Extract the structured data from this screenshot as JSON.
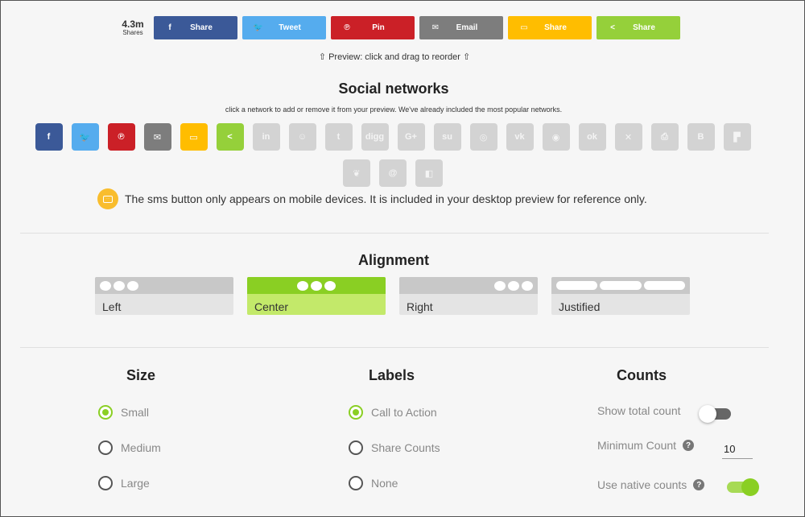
{
  "colors": {
    "facebook": "#3b5998",
    "twitter": "#55acee",
    "pinterest": "#cb2027",
    "email": "#7d7d7d",
    "sms": "#ffbd00",
    "share": "#95d03a",
    "inactive": "#d3d3d3",
    "accent": "#8acf23"
  },
  "share_bar": {
    "total_count": "4.3m",
    "total_label": "Shares",
    "buttons": [
      {
        "network": "facebook",
        "icon": "facebook-icon",
        "glyph": "f",
        "label": "Share"
      },
      {
        "network": "twitter",
        "icon": "twitter-icon",
        "glyph": "🐦",
        "label": "Tweet"
      },
      {
        "network": "pinterest",
        "icon": "pinterest-icon",
        "glyph": "℗",
        "label": "Pin"
      },
      {
        "network": "email",
        "icon": "email-icon",
        "glyph": "✉",
        "label": "Email"
      },
      {
        "network": "sms",
        "icon": "sms-icon",
        "glyph": "▭",
        "label": "Share"
      },
      {
        "network": "share",
        "icon": "share-icon",
        "glyph": "<",
        "label": "Share"
      }
    ]
  },
  "preview_note": "⇧ Preview: click and drag to reorder ⇧",
  "social_networks": {
    "title": "Social networks",
    "subtitle": "click a network to add or remove it from your preview. We've already included the most popular networks.",
    "networks": [
      {
        "name": "facebook",
        "icon": "facebook-icon",
        "glyph": "f",
        "active": true,
        "color": "#3b5998"
      },
      {
        "name": "twitter",
        "icon": "twitter-icon",
        "glyph": "🐦",
        "active": true,
        "color": "#55acee"
      },
      {
        "name": "pinterest",
        "icon": "pinterest-icon",
        "glyph": "℗",
        "active": true,
        "color": "#cb2027"
      },
      {
        "name": "email",
        "icon": "email-icon",
        "glyph": "✉",
        "active": true,
        "color": "#7d7d7d"
      },
      {
        "name": "sms",
        "icon": "sms-icon",
        "glyph": "▭",
        "active": true,
        "color": "#ffbd00"
      },
      {
        "name": "share",
        "icon": "share-icon",
        "glyph": "<",
        "active": true,
        "color": "#95d03a"
      },
      {
        "name": "linkedin",
        "icon": "linkedin-icon",
        "glyph": "in",
        "active": false
      },
      {
        "name": "reddit",
        "icon": "reddit-icon",
        "glyph": "☺",
        "active": false
      },
      {
        "name": "tumblr",
        "icon": "tumblr-icon",
        "glyph": "t",
        "active": false
      },
      {
        "name": "digg",
        "icon": "digg-icon",
        "glyph": "digg",
        "active": false
      },
      {
        "name": "google-plus",
        "icon": "google-plus-icon",
        "glyph": "G+",
        "active": false
      },
      {
        "name": "stumbleupon",
        "icon": "stumbleupon-icon",
        "glyph": "su",
        "active": false
      },
      {
        "name": "whatsapp",
        "icon": "whatsapp-icon",
        "glyph": "◎",
        "active": false
      },
      {
        "name": "vk",
        "icon": "vk-icon",
        "glyph": "vk",
        "active": false
      },
      {
        "name": "weibo",
        "icon": "weibo-icon",
        "glyph": "◉",
        "active": false
      },
      {
        "name": "odnoklassniki",
        "icon": "odnoklassniki-icon",
        "glyph": "ok",
        "active": false
      },
      {
        "name": "xing",
        "icon": "xing-icon",
        "glyph": "✕",
        "active": false
      },
      {
        "name": "print",
        "icon": "print-icon",
        "glyph": "⎙",
        "active": false
      },
      {
        "name": "blogger",
        "icon": "blogger-icon",
        "glyph": "B",
        "active": false
      },
      {
        "name": "flipboard",
        "icon": "flipboard-icon",
        "glyph": "▛",
        "active": false
      },
      {
        "name": "evernote",
        "icon": "evernote-icon",
        "glyph": "❦",
        "active": false
      },
      {
        "name": "mail-at",
        "icon": "at-icon",
        "glyph": "@",
        "active": false
      },
      {
        "name": "delicious",
        "icon": "delicious-icon",
        "glyph": "◧",
        "active": false
      }
    ]
  },
  "sms_notice": "The sms button only appears on mobile devices. It is included in your desktop preview for reference only.",
  "alignment": {
    "title": "Alignment",
    "options": [
      {
        "label": "Left",
        "selected": false
      },
      {
        "label": "Center",
        "selected": true
      },
      {
        "label": "Right",
        "selected": false
      },
      {
        "label": "Justified",
        "selected": false
      }
    ]
  },
  "size": {
    "title": "Size",
    "options": [
      {
        "label": "Small",
        "selected": true
      },
      {
        "label": "Medium",
        "selected": false
      },
      {
        "label": "Large",
        "selected": false
      }
    ]
  },
  "labels": {
    "title": "Labels",
    "options": [
      {
        "label": "Call to Action",
        "selected": true
      },
      {
        "label": "Share Counts",
        "selected": false
      },
      {
        "label": "None",
        "selected": false
      }
    ]
  },
  "counts": {
    "title": "Counts",
    "show_total_label": "Show total count",
    "show_total_on": false,
    "minimum_label": "Minimum Count",
    "minimum_value": "10",
    "native_label": "Use native counts",
    "native_on": true,
    "help_glyph": "?"
  }
}
